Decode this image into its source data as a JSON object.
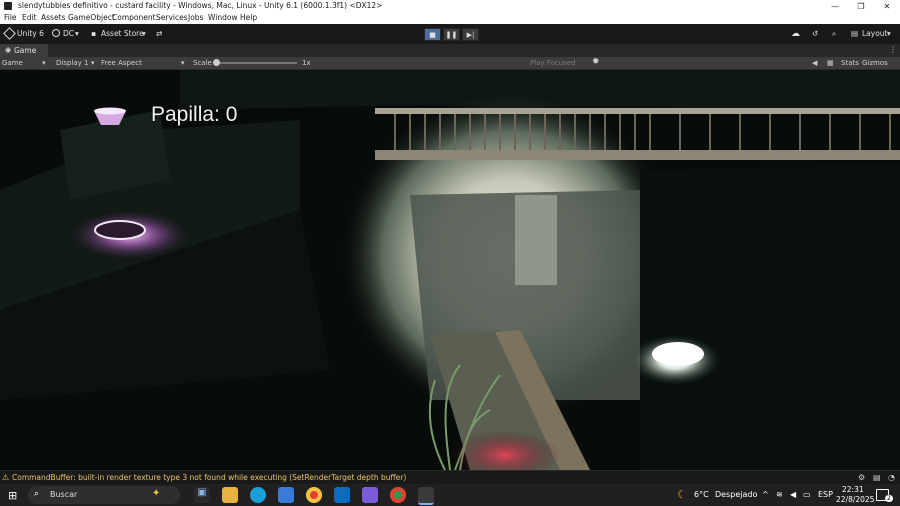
{
  "window": {
    "title": "slendytubbies  definitivo - custard facility - Windows, Mac, Linux - Unity 6.1 (6000.1.3f1) <DX12>",
    "controls": [
      "—",
      "❐",
      "✕"
    ]
  },
  "menubar": [
    "File",
    "Edit",
    "Assets",
    "GameObject",
    "Component",
    "Services",
    "Jobs",
    "Window",
    "Help"
  ],
  "toolbar": {
    "unity_label": "Unity 6",
    "account_label": "DC",
    "asset_store_label": "Asset Store",
    "layout_label": "Layout"
  },
  "tab": {
    "label": "Game"
  },
  "gamebar": {
    "view_label": "Game",
    "display_label": "Display 1",
    "aspect_label": "Free Aspect",
    "scale_label": "Scale",
    "scale_value": "1x",
    "play_focused_label": "Play Focused",
    "stats_label": "Stats",
    "gizmos_label": "Gizmos"
  },
  "hud": {
    "text": "Papilla: 0"
  },
  "console": {
    "message": "CommandBuffer: built-in render texture type 3 not found while executing  (SetRenderTarget depth buffer)"
  },
  "taskbar": {
    "search_placeholder": "Buscar",
    "weather_temp": "6°C",
    "weather_text": "Despejado",
    "language": "ESP",
    "time": "22:31",
    "date": "22/8/2025",
    "notification_count": "2"
  },
  "colors": {
    "warning": "#e9c46a",
    "editor_bg": "#191919",
    "game_bg": "#050807"
  }
}
